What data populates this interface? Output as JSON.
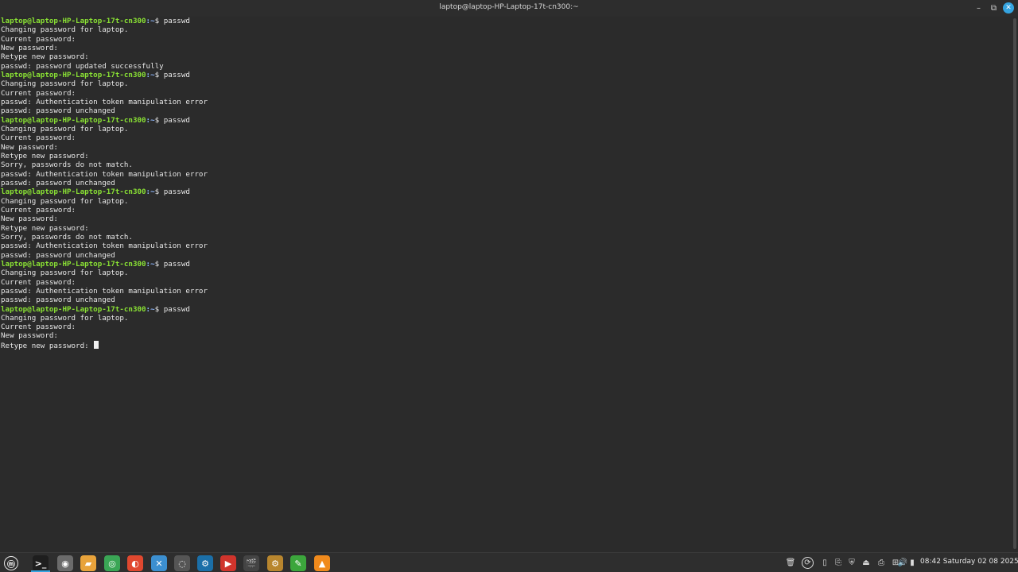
{
  "window": {
    "title": "laptop@laptop-HP-Laptop-17t-cn300:~",
    "minimize_glyph": "–",
    "maximize_glyph": "⧉",
    "close_glyph": "✕"
  },
  "terminal": {
    "prompt_user_host": "laptop@laptop-HP-Laptop-17t-cn300",
    "prompt_path": ":~",
    "prompt_symbol": "$ ",
    "lines": [
      {
        "kind": "prompt",
        "text": "passwd"
      },
      {
        "kind": "output",
        "text": "Changing password for laptop."
      },
      {
        "kind": "output",
        "text": "Current password:"
      },
      {
        "kind": "output",
        "text": "New password:"
      },
      {
        "kind": "output",
        "text": "Retype new password:"
      },
      {
        "kind": "output",
        "text": "passwd: password updated successfully"
      },
      {
        "kind": "prompt",
        "text": "passwd"
      },
      {
        "kind": "output",
        "text": "Changing password for laptop."
      },
      {
        "kind": "output",
        "text": "Current password:"
      },
      {
        "kind": "output",
        "text": "passwd: Authentication token manipulation error"
      },
      {
        "kind": "output",
        "text": "passwd: password unchanged"
      },
      {
        "kind": "prompt",
        "text": "passwd"
      },
      {
        "kind": "output",
        "text": "Changing password for laptop."
      },
      {
        "kind": "output",
        "text": "Current password:"
      },
      {
        "kind": "output",
        "text": "New password:"
      },
      {
        "kind": "output",
        "text": "Retype new password:"
      },
      {
        "kind": "output",
        "text": "Sorry, passwords do not match."
      },
      {
        "kind": "output",
        "text": "passwd: Authentication token manipulation error"
      },
      {
        "kind": "output",
        "text": "passwd: password unchanged"
      },
      {
        "kind": "prompt",
        "text": "passwd"
      },
      {
        "kind": "output",
        "text": "Changing password for laptop."
      },
      {
        "kind": "output",
        "text": "Current password:"
      },
      {
        "kind": "output",
        "text": "New password:"
      },
      {
        "kind": "output",
        "text": "Retype new password:"
      },
      {
        "kind": "output",
        "text": "Sorry, passwords do not match."
      },
      {
        "kind": "output",
        "text": "passwd: Authentication token manipulation error"
      },
      {
        "kind": "output",
        "text": "passwd: password unchanged"
      },
      {
        "kind": "prompt",
        "text": "passwd"
      },
      {
        "kind": "output",
        "text": "Changing password for laptop."
      },
      {
        "kind": "output",
        "text": "Current password:"
      },
      {
        "kind": "output",
        "text": "passwd: Authentication token manipulation error"
      },
      {
        "kind": "output",
        "text": "passwd: password unchanged"
      },
      {
        "kind": "prompt",
        "text": "passwd"
      },
      {
        "kind": "output",
        "text": "Changing password for laptop."
      },
      {
        "kind": "output",
        "text": "Current password:"
      },
      {
        "kind": "output",
        "text": "New password:"
      },
      {
        "kind": "input",
        "text": "Retype new password: "
      }
    ]
  },
  "taskbar": {
    "apps": [
      {
        "name": "menu-button",
        "glyph": "ⓜ",
        "color": "#3a3a3a",
        "active": false
      },
      {
        "name": "terminal-app",
        "glyph": ">_",
        "color": "#1e1e1e",
        "active": true
      },
      {
        "name": "text-editor-app",
        "glyph": "◉",
        "color": "#6b6b6b",
        "active": false
      },
      {
        "name": "files-app",
        "glyph": "▰",
        "color": "#e8a33b",
        "active": false
      },
      {
        "name": "chrome-app",
        "glyph": "◎",
        "color": "#3aa655",
        "active": false
      },
      {
        "name": "screenshot-app",
        "glyph": "◐",
        "color": "#e0482f",
        "active": false
      },
      {
        "name": "kdenlive-app",
        "glyph": "✕",
        "color": "#3c8fd0",
        "active": false
      },
      {
        "name": "system-monitor-app",
        "glyph": "◌",
        "color": "#555555",
        "active": false
      },
      {
        "name": "steam-app",
        "glyph": "⚙",
        "color": "#1b6fa8",
        "active": false
      },
      {
        "name": "presentation-app",
        "glyph": "▶",
        "color": "#d0342c",
        "active": false
      },
      {
        "name": "video-editor-app",
        "glyph": "🎬",
        "color": "#444444",
        "active": false
      },
      {
        "name": "settings-app",
        "glyph": "⚙",
        "color": "#b8862e",
        "active": false
      },
      {
        "name": "drawing-app",
        "glyph": "✎",
        "color": "#3ca63c",
        "active": false
      },
      {
        "name": "vlc-app",
        "glyph": "▲",
        "color": "#f08a1c",
        "active": false
      }
    ],
    "tray": [
      {
        "name": "trash-icon",
        "glyph": "🗑"
      },
      {
        "name": "update-icon",
        "glyph": "⟳"
      },
      {
        "name": "toggle-icon",
        "glyph": "▯"
      },
      {
        "name": "clipboard-icon",
        "glyph": "⎘"
      },
      {
        "name": "shield-icon",
        "glyph": "⛨"
      },
      {
        "name": "drive-icon",
        "glyph": "⏏"
      },
      {
        "name": "printer-icon",
        "glyph": "⎙"
      },
      {
        "name": "network-icon",
        "glyph": "⊞"
      },
      {
        "name": "volume-icon",
        "glyph": "🔊"
      },
      {
        "name": "battery-icon",
        "glyph": "▮"
      }
    ],
    "clock": "08:42 Saturday 02 08 2025"
  }
}
